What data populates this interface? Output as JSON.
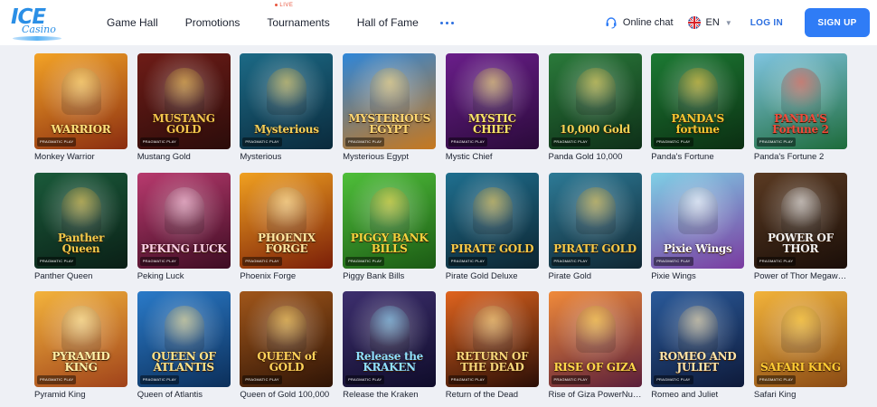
{
  "brand": {
    "logo_top": "ICE",
    "logo_bottom": "Casino"
  },
  "nav": {
    "items": [
      {
        "label": "Game Hall"
      },
      {
        "label": "Promotions"
      },
      {
        "label": "Tournaments",
        "badge": "LIVE"
      },
      {
        "label": "Hall of Fame"
      }
    ],
    "more_icon": "more-dots-icon"
  },
  "header_right": {
    "chat_label": "Online chat",
    "lang_label": "EN",
    "login_label": "LOG IN",
    "signup_label": "SIGN UP"
  },
  "colors": {
    "accent": "#2f7cf6",
    "live": "#e8553e",
    "background": "#eef0f5"
  },
  "provider_badge": "PRAGMATIC PLAY",
  "games": [
    {
      "title": "Monkey Warrior",
      "logo": "WARRIOR",
      "bg": [
        "#f3a326",
        "#8a2c10"
      ],
      "logo_color": "#ffe07a"
    },
    {
      "title": "Mustang Gold",
      "logo": "MUSTANG GOLD",
      "bg": [
        "#6e1c17",
        "#2b0c0a"
      ],
      "logo_color": "#f4c64d"
    },
    {
      "title": "Mysterious",
      "logo": "Mysterious",
      "bg": [
        "#1c6a86",
        "#0a2a3c"
      ],
      "logo_color": "#f2cf5a"
    },
    {
      "title": "Mysterious Egypt",
      "logo": "MYSTERIOUS EGYPT",
      "bg": [
        "#2f86d8",
        "#c7781e"
      ],
      "logo_color": "#ffd873"
    },
    {
      "title": "Mystic Chief",
      "logo": "MYSTIC CHIEF",
      "bg": [
        "#6a1e8a",
        "#2a0a3a"
      ],
      "logo_color": "#f7e36a"
    },
    {
      "title": "Panda Gold 10,000",
      "logo": "10,000 Gold",
      "bg": [
        "#2a7a3a",
        "#0e2f18"
      ],
      "logo_color": "#f3d154"
    },
    {
      "title": "Panda's Fortune",
      "logo": "PANDA'S fortune",
      "bg": [
        "#1c7a33",
        "#0b2e12"
      ],
      "logo_color": "#f7c532"
    },
    {
      "title": "Panda's Fortune 2",
      "logo": "PANDA'S Fortune 2",
      "bg": [
        "#7fc4e0",
        "#1d6b3a"
      ],
      "logo_color": "#f04a3a"
    },
    {
      "title": "Panther Queen",
      "logo": "Panther Queen",
      "bg": [
        "#1a5a3a",
        "#0a1f16"
      ],
      "logo_color": "#f2c94a"
    },
    {
      "title": "Peking Luck",
      "logo": "PEKING LUCK",
      "bg": [
        "#b83a6e",
        "#3d0c22"
      ],
      "logo_color": "#ffd0e6"
    },
    {
      "title": "Phoenix Forge",
      "logo": "PHOENIX FORGE",
      "bg": [
        "#f0a020",
        "#7a1e08"
      ],
      "logo_color": "#ffe7a0"
    },
    {
      "title": "Piggy Bank Bills",
      "logo": "PIGGY BANK BILLS",
      "bg": [
        "#4fbf3a",
        "#1b5a14"
      ],
      "logo_color": "#f6d33e"
    },
    {
      "title": "Pirate Gold Deluxe",
      "logo": "PIRATE GOLD",
      "bg": [
        "#1f6f8f",
        "#0c2430"
      ],
      "logo_color": "#f5c949"
    },
    {
      "title": "Pirate Gold",
      "logo": "PIRATE GOLD",
      "bg": [
        "#2d7a96",
        "#0f2632"
      ],
      "logo_color": "#f5c949"
    },
    {
      "title": "Pixie Wings",
      "logo": "Pixie Wings",
      "bg": [
        "#7fd0e6",
        "#7a3aa0"
      ],
      "logo_color": "#ffffff"
    },
    {
      "title": "Power of Thor Megaways",
      "logo": "POWER OF THOR",
      "bg": [
        "#5a3a22",
        "#1a0e08"
      ],
      "logo_color": "#f2f2f2"
    },
    {
      "title": "Pyramid King",
      "logo": "PYRAMID KING",
      "bg": [
        "#f3b33c",
        "#a0421a"
      ],
      "logo_color": "#fff1a8"
    },
    {
      "title": "Queen of Atlantis",
      "logo": "QUEEN OF ATLANTIS",
      "bg": [
        "#2a7ac8",
        "#0c2f5a"
      ],
      "logo_color": "#ffe48a"
    },
    {
      "title": "Queen of Gold 100,000",
      "logo": "QUEEN of GOLD",
      "bg": [
        "#a0561a",
        "#2f1406"
      ],
      "logo_color": "#ffd35a"
    },
    {
      "title": "Release the Kraken",
      "logo": "Release the KRAKEN",
      "bg": [
        "#3d2f6e",
        "#0f0c2a"
      ],
      "logo_color": "#8fe0ff"
    },
    {
      "title": "Return of the Dead",
      "logo": "RETURN OF THE DEAD",
      "bg": [
        "#e0641e",
        "#2a0e06"
      ],
      "logo_color": "#f8d77a"
    },
    {
      "title": "Rise of Giza PowerNudge",
      "logo": "RISE OF GIZA",
      "bg": [
        "#f08a3a",
        "#5a1e3a"
      ],
      "logo_color": "#ffd84a"
    },
    {
      "title": "Romeo and Juliet",
      "logo": "ROMEO AND JULIET",
      "bg": [
        "#2a5a9a",
        "#0e1a3a"
      ],
      "logo_color": "#ffe4a8"
    },
    {
      "title": "Safari King",
      "logo": "SAFARI KING",
      "bg": [
        "#f2b33a",
        "#8a4a14"
      ],
      "logo_color": "#ffcc33"
    }
  ]
}
